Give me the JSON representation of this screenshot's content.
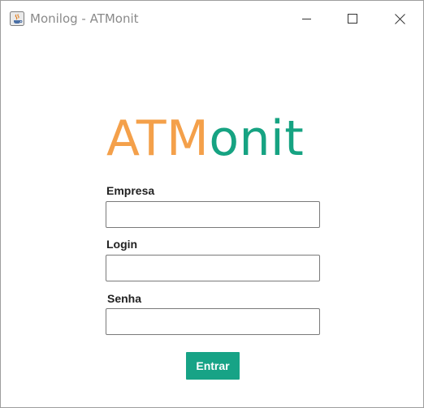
{
  "window": {
    "title": "Monilog - ATMonit",
    "icon": "java-app-icon",
    "controls": [
      "minimize-icon",
      "maximize-icon",
      "close-icon"
    ]
  },
  "logo": {
    "part1": "ATM",
    "part2": "onit",
    "color1": "#f4a04a",
    "color2": "#16a382"
  },
  "form": {
    "empresa_label": "Empresa",
    "empresa_value": "",
    "login_label": "Login",
    "login_value": "",
    "senha_label": "Senha",
    "senha_value": "",
    "submit_label": "Entrar",
    "submit_color": "#17a386"
  }
}
